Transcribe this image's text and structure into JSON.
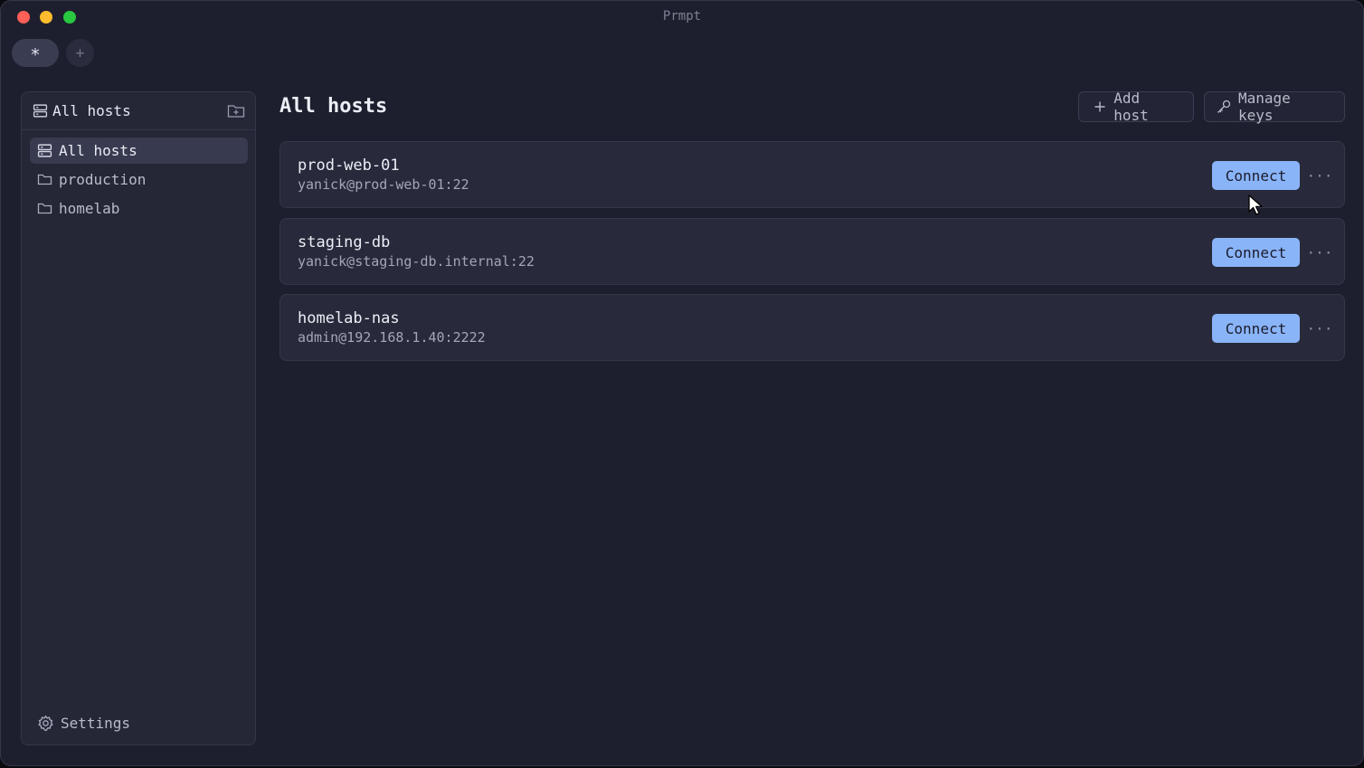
{
  "window": {
    "title": "Prmpt"
  },
  "tabs": {
    "active_label": "*",
    "new_tab_label": "+"
  },
  "sidebar": {
    "header_label": "All hosts",
    "items": [
      {
        "label": "All hosts",
        "icon": "server-icon",
        "active": true
      },
      {
        "label": "production",
        "icon": "folder-icon",
        "active": false
      },
      {
        "label": "homelab",
        "icon": "folder-icon",
        "active": false
      }
    ],
    "settings_label": "Settings"
  },
  "main": {
    "title": "All hosts",
    "add_host_label": "Add host",
    "manage_keys_label": "Manage keys",
    "hosts": [
      {
        "name": "prod-web-01",
        "address": "yanick@prod-web-01:22",
        "connect_label": "Connect"
      },
      {
        "name": "staging-db",
        "address": "yanick@staging-db.internal:22",
        "connect_label": "Connect"
      },
      {
        "name": "homelab-nas",
        "address": "admin@192.168.1.40:2222",
        "connect_label": "Connect"
      }
    ],
    "more_label": "···"
  },
  "colors": {
    "background": "#1e1f2e",
    "panel": "#252636",
    "card": "#282a3b",
    "accent": "#8ab4f8",
    "border": "#34364a"
  }
}
